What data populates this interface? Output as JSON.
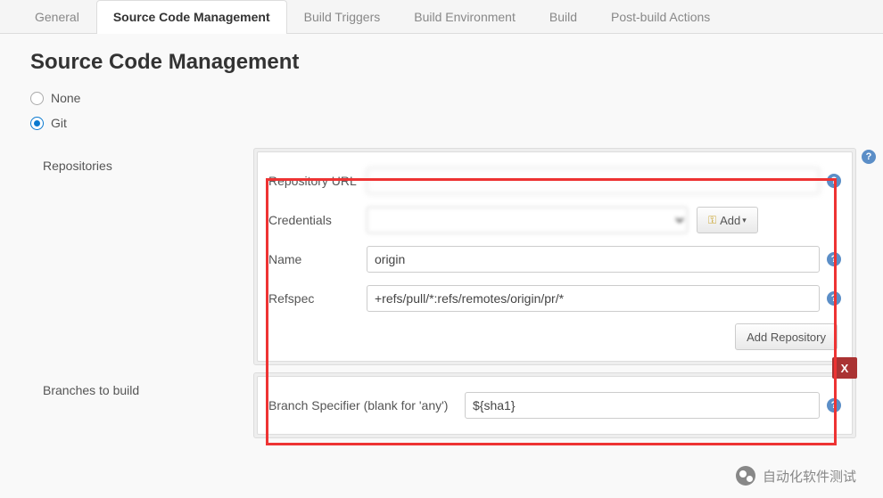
{
  "tabs": {
    "general": "General",
    "scm": "Source Code Management",
    "triggers": "Build Triggers",
    "env": "Build Environment",
    "build": "Build",
    "post": "Post-build Actions"
  },
  "heading": "Source Code Management",
  "scm_options": {
    "none": "None",
    "git": "Git"
  },
  "sections": {
    "repositories": "Repositories",
    "branches": "Branches to build"
  },
  "fields": {
    "repo_url_label": "Repository URL",
    "repo_url_value": "",
    "credentials_label": "Credentials",
    "credentials_value": "",
    "add_button": "Add",
    "name_label": "Name",
    "name_value": "origin",
    "refspec_label": "Refspec",
    "refspec_value": "+refs/pull/*:refs/remotes/origin/pr/*",
    "add_repo_button": "Add Repository",
    "branch_label": "Branch Specifier (blank for 'any')",
    "branch_value": "${sha1}",
    "delete_label": "X"
  },
  "watermark": "自动化软件测试"
}
